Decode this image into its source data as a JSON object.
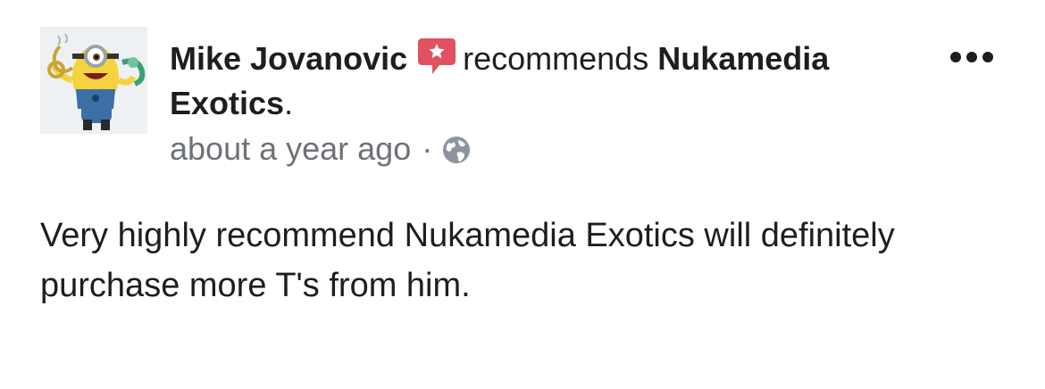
{
  "post": {
    "author": "Mike Jovanovic",
    "action_text": "recommends",
    "page_name": "Nukamedia Exotics",
    "page_suffix": ".",
    "timestamp": "about a year ago",
    "separator": "·",
    "audience_icon": "globe-icon",
    "recommend_icon": "recommend-star-icon",
    "menu_icon": "more-options-icon",
    "body": "Very highly recommend Nukamedia Exotics will definitely purchase more T's from him."
  },
  "colors": {
    "recommend_badge": "#e2515f",
    "secondary_text": "#6e7277",
    "primary_text": "#1c1e21"
  }
}
